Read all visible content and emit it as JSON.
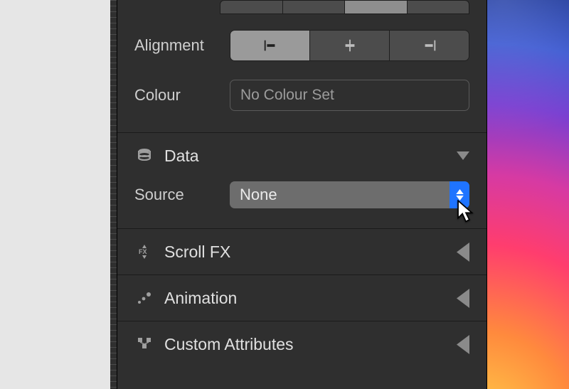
{
  "text_section": {
    "alignment_label": "Alignment",
    "colour_label": "Colour",
    "colour_value": "No Colour Set"
  },
  "data_section": {
    "title": "Data",
    "source_label": "Source",
    "source_value": "None"
  },
  "scrollfx_section": {
    "title": "Scroll FX"
  },
  "animation_section": {
    "title": "Animation"
  },
  "custom_attributes_section": {
    "title": "Custom Attributes"
  }
}
